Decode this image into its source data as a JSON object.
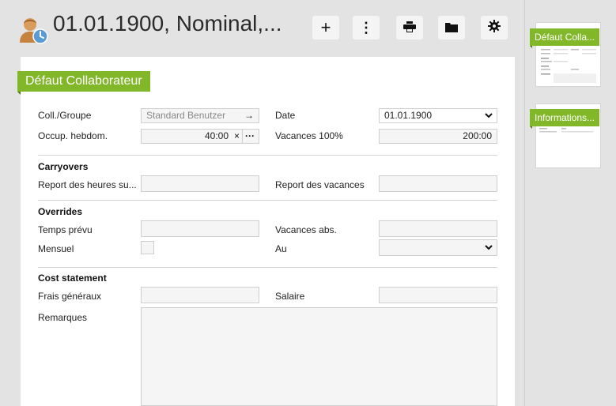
{
  "header": {
    "title": "01.01.1900, Nominal,...",
    "icon": "user-clock-icon"
  },
  "toolbar": {
    "add_label": "+",
    "more_label": "⋮",
    "print_icon": "print-icon",
    "folder_icon": "folder-icon",
    "settings_icon": "gear-icon"
  },
  "form": {
    "section_title": "Défaut Collaborateur",
    "coll_groupe": {
      "label": "Coll./Groupe",
      "value": "Standard Benutzer",
      "arrow": "→"
    },
    "date": {
      "label": "Date",
      "value": "01.01.1900"
    },
    "occup": {
      "label": "Occup. hebdom.",
      "value": "40:00",
      "clear": "×",
      "more": "···"
    },
    "vacances100": {
      "label": "Vacances 100%",
      "value": "200:00"
    },
    "carryovers": {
      "title": "Carryovers",
      "report_heures": "Report des heures su...",
      "report_vacances": "Report des vacances"
    },
    "overrides": {
      "title": "Overrides",
      "temps_prevu": "Temps prévu",
      "vacances_abs": "Vacances abs.",
      "mensuel": "Mensuel",
      "au": "Au"
    },
    "cost": {
      "title": "Cost statement",
      "frais": "Frais généraux",
      "salaire": "Salaire"
    },
    "remarques": "Remarques"
  },
  "sidepanel": {
    "pages": [
      {
        "label": "Défaut Colla..."
      },
      {
        "label": "Informations..."
      }
    ]
  },
  "colors": {
    "accent": "#82b72a",
    "background": "#e3e3e3"
  }
}
